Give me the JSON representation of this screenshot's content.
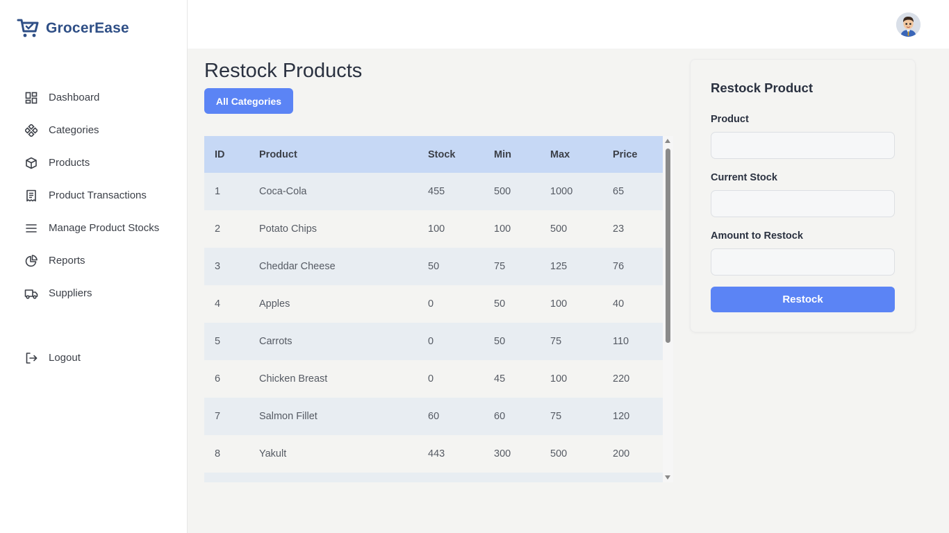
{
  "app": {
    "name": "GrocerEase"
  },
  "sidebar": {
    "items": [
      {
        "label": "Dashboard",
        "icon": "dashboard-icon"
      },
      {
        "label": "Categories",
        "icon": "categories-icon"
      },
      {
        "label": "Products",
        "icon": "box-icon"
      },
      {
        "label": "Product Transactions",
        "icon": "receipt-icon"
      },
      {
        "label": "Manage Product Stocks",
        "icon": "menu-lines-icon"
      },
      {
        "label": "Reports",
        "icon": "pie-chart-icon"
      },
      {
        "label": "Suppliers",
        "icon": "truck-icon"
      }
    ],
    "logout": {
      "label": "Logout",
      "icon": "logout-icon"
    }
  },
  "topbar": {
    "avatar": "user-avatar"
  },
  "main": {
    "title": "Restock Products",
    "category_filter": "All Categories",
    "table": {
      "columns": [
        "ID",
        "Product",
        "Stock",
        "Min",
        "Max",
        "Price"
      ],
      "rows": [
        [
          "1",
          "Coca-Cola",
          "455",
          "500",
          "1000",
          "65"
        ],
        [
          "2",
          "Potato Chips",
          "100",
          "100",
          "500",
          "23"
        ],
        [
          "3",
          "Cheddar Cheese",
          "50",
          "75",
          "125",
          "76"
        ],
        [
          "4",
          "Apples",
          "0",
          "50",
          "100",
          "40"
        ],
        [
          "5",
          "Carrots",
          "0",
          "50",
          "75",
          "110"
        ],
        [
          "6",
          "Chicken Breast",
          "0",
          "45",
          "100",
          "220"
        ],
        [
          "7",
          "Salmon Fillet",
          "60",
          "60",
          "75",
          "120"
        ],
        [
          "8",
          "Yakult",
          "443",
          "300",
          "500",
          "200"
        ]
      ]
    }
  },
  "restock_form": {
    "title": "Restock Product",
    "product_label": "Product",
    "product_value": "",
    "current_stock_label": "Current Stock",
    "current_stock_value": "",
    "amount_label": "Amount to Restock",
    "amount_value": "",
    "submit_label": "Restock"
  },
  "colors": {
    "brand": "#2f4f86",
    "accent": "#5b84f5",
    "table_header": "#c6d8f5",
    "row_alt": "#e8edf2"
  }
}
